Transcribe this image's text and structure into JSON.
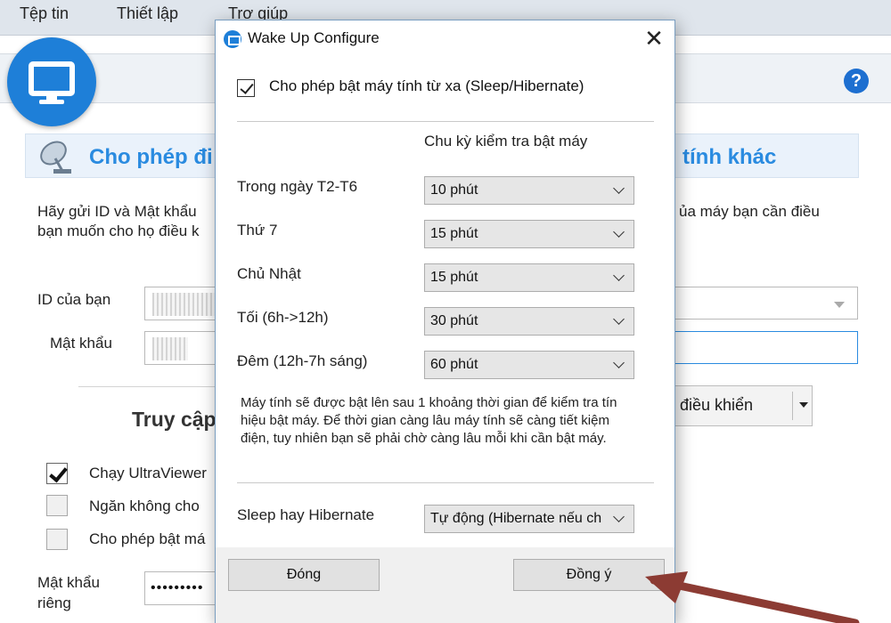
{
  "app": {
    "menu": [
      "Tệp tin",
      "Thiết lập",
      "Trợ giúp"
    ],
    "help_symbol": "?",
    "section_title_left": "Cho phép đi",
    "section_title_right": "tính khác",
    "intro_left_line1": "Hãy gửi ID và Mật khẩu",
    "intro_left_line2": "bạn muốn cho họ điều k",
    "intro_right_line1": "ủa máy bạn cần điều",
    "id_label": "ID của bạn",
    "password_label": "Mật khẩu",
    "access_heading": "Truy cập",
    "control_button": "điều khiển",
    "options": [
      "Chạy UltraViewer",
      "Ngăn không cho",
      "Cho phép bật má"
    ],
    "private_password_label_line1": "Mật khẩu",
    "private_password_label_line2": "riêng",
    "private_password_value": "•••••••••"
  },
  "dialog": {
    "title": "Wake Up Configure",
    "close_symbol": "✕",
    "enable_label": "Cho phép bật máy tính từ xa (Sleep/Hibernate)",
    "enable_checked": true,
    "column_header": "Chu kỳ kiểm tra bật máy",
    "rows": [
      {
        "label": "Trong ngày T2-T6",
        "value": "10 phút"
      },
      {
        "label": "Thứ 7",
        "value": "15 phút"
      },
      {
        "label": "Chủ Nhật",
        "value": "15 phút"
      },
      {
        "label": "Tối (6h->12h)",
        "value": "30 phút"
      },
      {
        "label": "Đêm (12h-7h sáng)",
        "value": "60 phút"
      }
    ],
    "note": "Máy tính sẽ được bật lên sau 1 khoảng thời gian để kiểm tra tín hiệu bật máy. Để thời gian càng lâu máy tính sẽ càng tiết kiệm điện, tuy nhiên bạn sẽ phải chờ càng lâu mỗi khi cần bật máy.",
    "mode_label": "Sleep hay Hibernate",
    "mode_value": "Tự động (Hibernate nếu ch",
    "close_button": "Đóng",
    "ok_button": "Đồng ý"
  },
  "colors": {
    "accent": "#2a8be0",
    "annotation_arrow": "#8c3b33"
  }
}
